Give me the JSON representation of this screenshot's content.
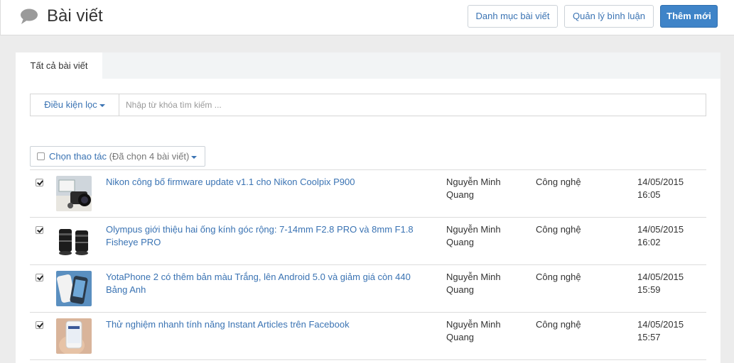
{
  "header": {
    "title": "Bài viết",
    "icon": "chat-bubble-icon",
    "buttons": {
      "categories": "Danh mục bài viết",
      "comments": "Quản lý bình luận",
      "add_new": "Thêm mới"
    }
  },
  "tabs": [
    {
      "label": "Tất cả bài viết",
      "active": true
    }
  ],
  "filter": {
    "dropdown_label": "Điều kiện lọc",
    "search_placeholder": "Nhập từ khóa tìm kiếm ...",
    "search_value": ""
  },
  "bulk_action": {
    "label": "Chọn thao tác",
    "selected_count": "(Đã chọn 4 bài viết)",
    "checked": false
  },
  "posts": [
    {
      "checked": true,
      "title": "Nikon công bố firmware update v1.1 cho Nikon Coolpix P900",
      "author": "Nguyễn Minh Quang",
      "category": "Công nghệ",
      "date": "14/05/2015",
      "time": "16:05",
      "thumbnail": "camera-photo"
    },
    {
      "checked": true,
      "title": "Olympus giới thiệu hai ống kính góc rộng: 7-14mm F2.8 PRO và 8mm F1.8 Fisheye PRO",
      "author": "Nguyễn Minh Quang",
      "category": "Công nghệ",
      "date": "14/05/2015",
      "time": "16:02",
      "thumbnail": "lens-photo"
    },
    {
      "checked": true,
      "title": "YotaPhone 2 có thêm bản màu Trắng, lên Android 5.0 và giảm giá còn 440 Bảng Anh",
      "author": "Nguyễn Minh Quang",
      "category": "Công nghệ",
      "date": "14/05/2015",
      "time": "15:59",
      "thumbnail": "phone-photo"
    },
    {
      "checked": true,
      "title": "Thử nghiệm nhanh tính năng Instant Articles trên Facebook",
      "author": "Nguyễn Minh Quang",
      "category": "Công nghệ",
      "date": "14/05/2015",
      "time": "15:57",
      "thumbnail": "hand-phone-photo"
    }
  ],
  "colors": {
    "link": "#3a73b3",
    "primary_button": "#3f84c8",
    "background": "#ececec"
  }
}
